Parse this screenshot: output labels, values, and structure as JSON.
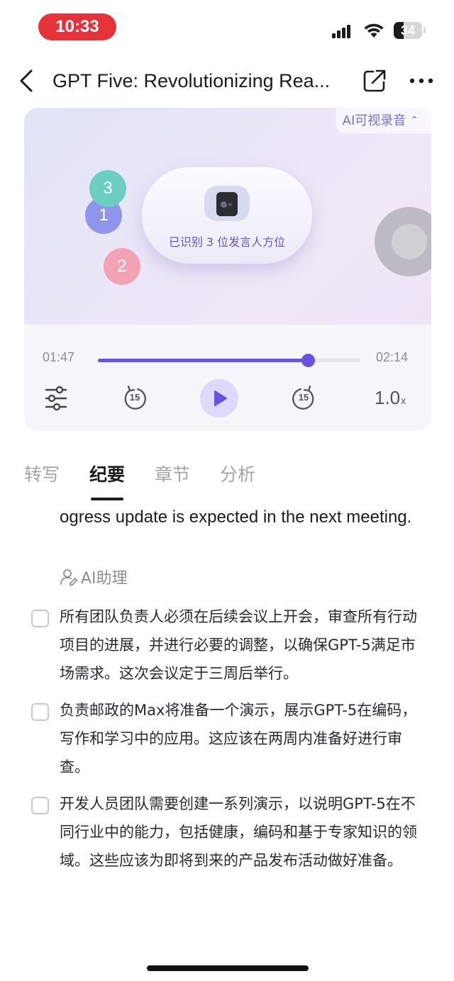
{
  "status_bar": {
    "time": "10:33",
    "battery": "34",
    "battery_level": 0.34
  },
  "nav": {
    "title": "GPT Five: Revolutionizing Rea..."
  },
  "player": {
    "ai_tag": "AI可视录音",
    "speakers": [
      "1",
      "2",
      "3"
    ],
    "device_label": "已识别 3 位发言人方位",
    "time_elapsed": "01:47",
    "time_total": "02:14",
    "progress": 0.8,
    "skip_back": "15",
    "skip_forward": "15",
    "speed": "1.0",
    "speed_unit": "x"
  },
  "tabs": [
    {
      "label": "转写",
      "active": false
    },
    {
      "label": "纪要",
      "active": true
    },
    {
      "label": "章节",
      "active": false
    },
    {
      "label": "分析",
      "active": false
    }
  ],
  "content": {
    "continued_text": "ogress update is expected in the next meeting.",
    "ai_assistant": "AI助理",
    "todos": [
      {
        "text": "所有团队负责人必须在后续会议上开会，审查所有行动项目的进展，并进行必要的调整，以确保GPT-5满足市场需求。这次会议定于三周后举行。",
        "checked": false
      },
      {
        "text": "负责邮政的Max将准备一个演示，展示GPT-5在编码，写作和学习中的应用。这应该在两周内准备好进行审查。",
        "checked": false
      },
      {
        "text": "开发人员团队需要创建一系列演示，以说明GPT-5在不同行业中的能力，包括健康，编码和基于专家知识的领域。这些应该为即将到来的产品发布活动做好准备。",
        "checked": false
      }
    ]
  },
  "colors": {
    "accent": "#6a52e0",
    "time_pill": "#e8323a",
    "speaker_1": "#8f95ec",
    "speaker_2": "#f3a2b5",
    "speaker_3": "#6ccdc2"
  }
}
